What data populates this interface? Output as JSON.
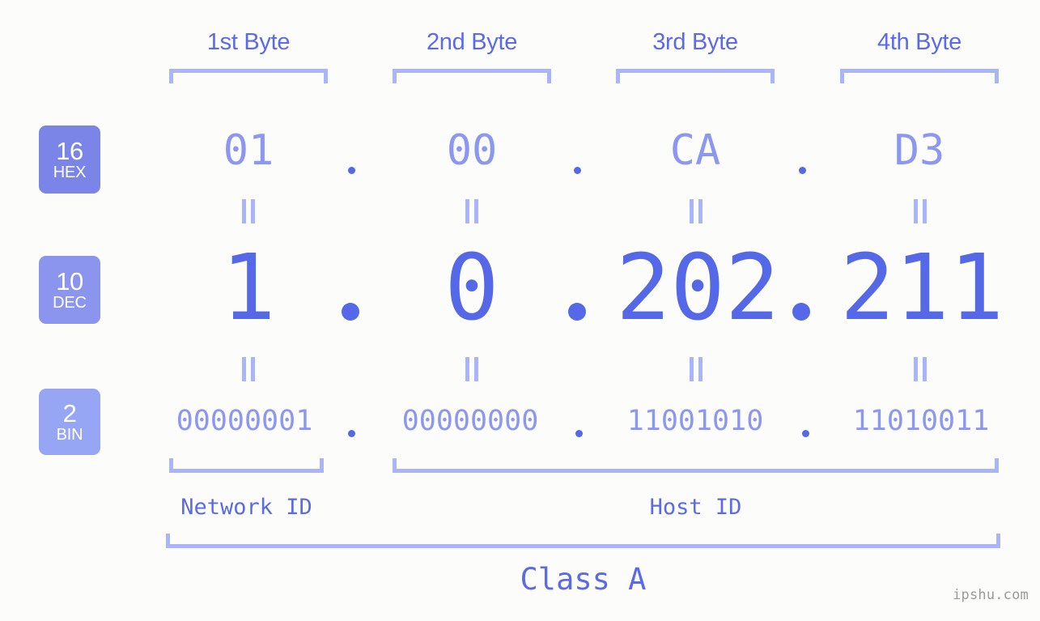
{
  "meta": {
    "background_color": "#fcfdfa",
    "bracket_color": "#aab4fa",
    "label_color": "#5b6ae8",
    "value_light_color": "#8b97f0",
    "value_strong_color": "#5568e8",
    "watermark": "ipshu.com"
  },
  "byte_headers": [
    {
      "label": "1st Byte"
    },
    {
      "label": "2nd Byte"
    },
    {
      "label": "3rd Byte"
    },
    {
      "label": "4th Byte"
    }
  ],
  "rows": {
    "hex": {
      "badge": {
        "radix": "16",
        "name": "HEX",
        "color": "#7b85e8"
      },
      "values": [
        "01",
        "00",
        "CA",
        "D3"
      ],
      "separator": "."
    },
    "dec": {
      "badge": {
        "radix": "10",
        "name": "DEC",
        "color": "#8b95ee"
      },
      "values": [
        "1",
        "0",
        "202",
        "211"
      ],
      "separator": "."
    },
    "bin": {
      "badge": {
        "radix": "2",
        "name": "BIN",
        "color": "#97a5f5"
      },
      "values": [
        "00000001",
        "00000000",
        "11001010",
        "11010011"
      ],
      "separator": "."
    }
  },
  "equivalence_marker": "=",
  "footer": {
    "network_id_label": "Network ID",
    "host_id_label": "Host ID",
    "class_label": "Class A"
  }
}
